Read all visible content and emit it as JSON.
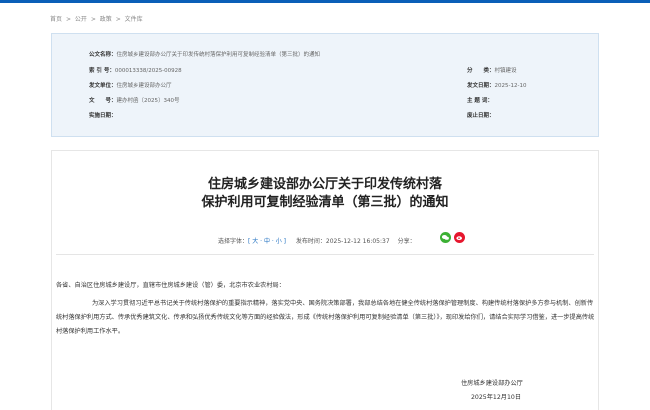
{
  "breadcrumb": [
    "首页",
    ">",
    "公开",
    ">",
    "政策",
    ">",
    "文件库"
  ],
  "info": {
    "fields": [
      {
        "key": "公文名称：",
        "value": "住房城乡建设部办公厅关于印发传统村落保护利用可复制经验清单（第三批）的通知"
      },
      {
        "key": "索 引 号：",
        "value": "000013338/2025-00928"
      },
      {
        "key": "发文单位：",
        "value": "住房城乡建设部办公厅"
      },
      {
        "key": "文　　号：",
        "value": "建办村函〔2025〕340号"
      },
      {
        "key": "实施日期：",
        "value": ""
      }
    ],
    "right_fields": [
      {
        "key": "分　　类：",
        "value": "村镇建设"
      },
      {
        "key": "发文日期：",
        "value": "2025-12-10"
      },
      {
        "key": "主 题 词：",
        "value": ""
      },
      {
        "key": "废止日期：",
        "value": ""
      }
    ]
  },
  "article": {
    "title_line1": "住房城乡建设部办公厅关于印发传统村落",
    "title_line2": "保护利用可复制经验清单（第三批）的通知",
    "font_label": "选择字体：",
    "font_sizes": "[ 大 · 中 · 小 ]",
    "publish_label": "发布时间：",
    "publish_time": "2025-12-12 16:05:37",
    "share_label": "分享：",
    "share_icons": [
      "wechat-icon",
      "weibo-icon"
    ],
    "addressee": "各省、自治区住房城乡建设厅，直辖市住房城乡建设（管）委，北京市农业农村局：",
    "body": "为深入学习贯彻习近平总书记关于传统村落保护的重要指示精神，落实党中央、国务院决策部署，我部总结各地在健全传统村落保护管理制度、构建传统村落保护多方参与机制、创新传统村落保护利用方式、传承优秀建筑文化、传承和弘扬优秀传统文化等方面的经验做法，形成《传统村落保护利用可复制经验清单（第三批）》，现印发给你们，请结合实际学习借鉴，进一步提高传统村落保护利用工作水平。",
    "signer": "住房城乡建设部办公厅",
    "sign_date": "2025年12月10日"
  },
  "colors": {
    "accent": "#1e6fc0",
    "wechat": "#3cb034",
    "weibo": "#e6162d",
    "info_bg": "#eef4fa"
  }
}
